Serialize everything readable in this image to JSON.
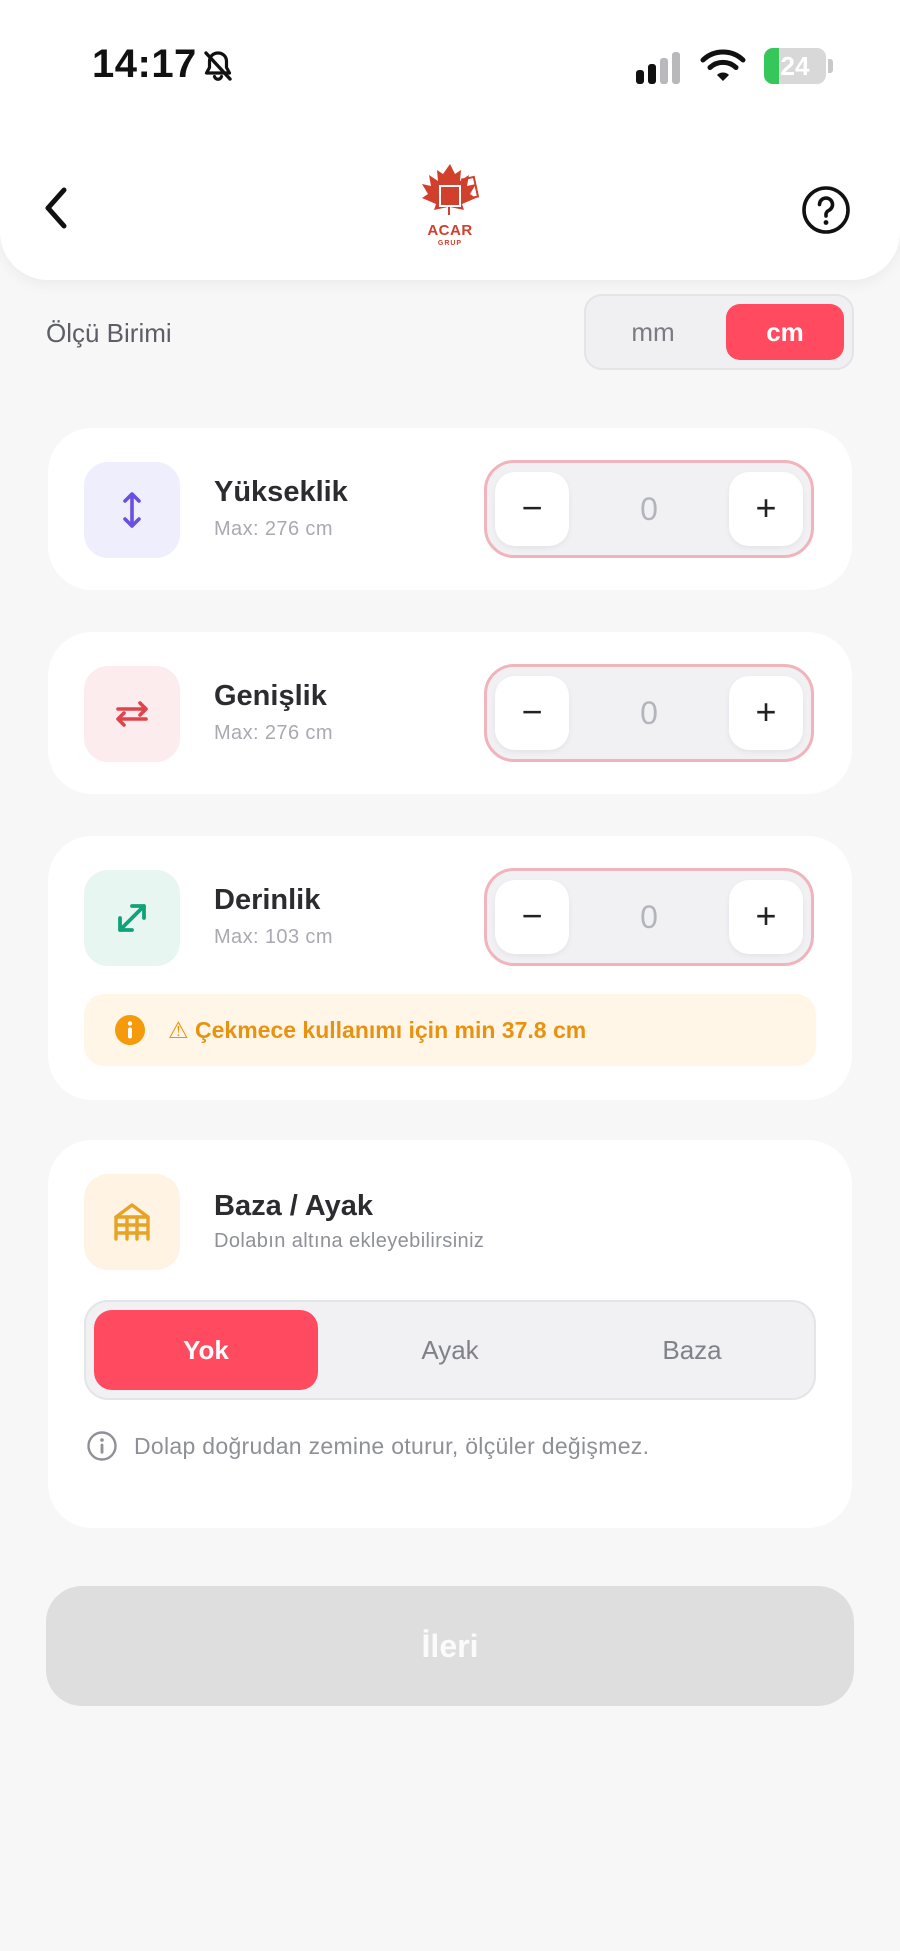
{
  "status_bar": {
    "time": "14:17",
    "battery_level": "24",
    "battery_fraction": 0.24,
    "icons": [
      "bell-slash-icon",
      "cellular-signal-icon",
      "wifi-icon",
      "battery-charging-icon"
    ]
  },
  "header": {
    "logo_text": "ACAR",
    "logo_subtext": "GRUP",
    "icons": [
      "chevron-left-icon",
      "question-circle-icon"
    ]
  },
  "unit": {
    "label": "Ölçü Birimi",
    "options": [
      "mm",
      "cm"
    ],
    "selected": "cm"
  },
  "dimensions": [
    {
      "id": "height",
      "title": "Yükseklik",
      "max_label": "Max: 276 cm",
      "value": "0",
      "icon": "vertical-arrows-icon",
      "icon_color": "#6a4fe0",
      "icon_bg": "#efeefd"
    },
    {
      "id": "width",
      "title": "Genişlik",
      "max_label": "Max: 276 cm",
      "value": "0",
      "icon": "horizontal-swap-arrows-icon",
      "icon_color": "#e0434b",
      "icon_bg": "#fdeced"
    },
    {
      "id": "depth",
      "title": "Derinlik",
      "max_label": "Max: 103 cm",
      "value": "0",
      "icon": "diagonal-arrows-icon",
      "icon_color": "#10a37a",
      "icon_bg": "#e7f6f1"
    }
  ],
  "stepper": {
    "minus": "−",
    "plus": "+"
  },
  "depth_warning": {
    "text": "⚠ Çekmece kullanımı için min 37.8 cm",
    "icon": "info-filled-icon",
    "color": "#e9920f"
  },
  "base": {
    "title": "Baza / Ayak",
    "subtitle": "Dolabın altına ekleyebilirsiniz",
    "icon": "base-legs-icon",
    "icon_color": "#e7a325",
    "icon_bg": "#fff4e4",
    "options": [
      "Yok",
      "Ayak",
      "Baza"
    ],
    "selected": "Yok",
    "info": "Dolap doğrudan zemine oturur, ölçüler değişmez."
  },
  "next_button": {
    "label": "İleri"
  },
  "colors": {
    "accent": "#ff4a5f",
    "disabled_button": "#dedede"
  }
}
